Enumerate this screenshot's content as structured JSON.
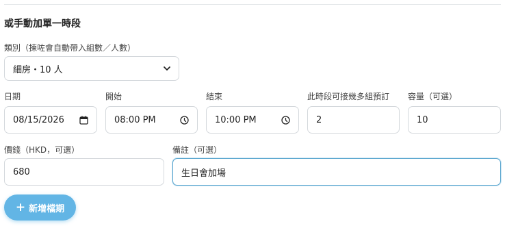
{
  "section": {
    "title": "或手動加單一時段"
  },
  "room": {
    "label": "類別（揀咗會自動帶入組數／人數）",
    "value": "細房・10 人"
  },
  "date": {
    "label": "日期",
    "value": "08/15/2026",
    "icon": "calendar-icon"
  },
  "start": {
    "label": "開始",
    "value": "08:00 PM",
    "icon": "clock-icon"
  },
  "end": {
    "label": "結束",
    "value": "10:00 PM",
    "icon": "clock-icon"
  },
  "groups": {
    "label": "此時段可接幾多組預訂",
    "value": "2"
  },
  "capacity": {
    "label": "容量（可選）",
    "value": "10"
  },
  "price": {
    "label": "價錢（HKD，可選）",
    "value": "680"
  },
  "note": {
    "label": "備註（可選）",
    "value": "生日會加場"
  },
  "add_button": {
    "label": "新增檔期",
    "icon": "plus-icon"
  },
  "colors": {
    "accent": "#62b5e5",
    "focus_border": "#5aa6cf",
    "border": "#d4d8dc"
  }
}
